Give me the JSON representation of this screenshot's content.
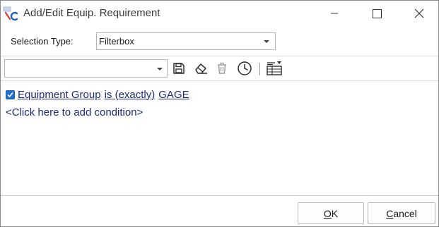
{
  "window": {
    "title": "Add/Edit Equip. Requirement",
    "controls": {
      "minimize": "minimize",
      "maximize": "maximize",
      "close": "close"
    }
  },
  "selection": {
    "label": "Selection Type:",
    "value": "Filterbox"
  },
  "toolbar": {
    "filter_value": "",
    "icons": [
      "save-icon",
      "eraser-icon",
      "trash-icon",
      "history-icon",
      "table-layout-icon"
    ]
  },
  "condition": {
    "checked": true,
    "field": "Equipment Group",
    "operator": "is (exactly)",
    "value": "GAGE"
  },
  "add_condition_text": "<Click here to add condition>",
  "buttons": {
    "ok": {
      "mnemonic": "O",
      "rest": "K"
    },
    "cancel": {
      "mnemonic": "C",
      "rest": "ancel"
    }
  },
  "colors": {
    "link": "#1c2a7d",
    "checkbox": "#1f6fd1",
    "icon_logo_red": "#d9463a",
    "icon_logo_blue": "#1f5fbf"
  }
}
